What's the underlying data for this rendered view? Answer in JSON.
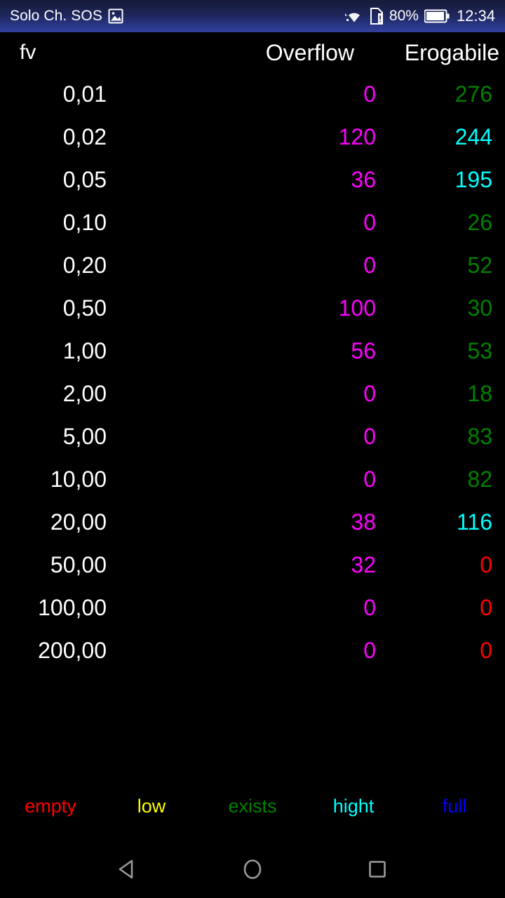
{
  "statusbar": {
    "carrier": "Solo Ch. SOS",
    "screenshot_icon": "image-icon",
    "wifi_icon": "wifi-icon",
    "sim_icon": "sim-card-alert-icon",
    "battery_percent": "80%",
    "battery_icon": "battery-icon",
    "clock": "12:34"
  },
  "table": {
    "headers": {
      "fv": "fv",
      "overflow": "Overflow",
      "erogabile": "Erogabile"
    },
    "rows": [
      {
        "fv": "0,01",
        "overflow": "0",
        "overflow_color": "#FF00FF",
        "erogabile": "276",
        "erogabile_color": "#008000"
      },
      {
        "fv": "0,02",
        "overflow": "120",
        "overflow_color": "#FF00FF",
        "erogabile": "244",
        "erogabile_color": "#00FFFF"
      },
      {
        "fv": "0,05",
        "overflow": "36",
        "overflow_color": "#FF00FF",
        "erogabile": "195",
        "erogabile_color": "#00FFFF"
      },
      {
        "fv": "0,10",
        "overflow": "0",
        "overflow_color": "#FF00FF",
        "erogabile": "26",
        "erogabile_color": "#008000"
      },
      {
        "fv": "0,20",
        "overflow": "0",
        "overflow_color": "#FF00FF",
        "erogabile": "52",
        "erogabile_color": "#008000"
      },
      {
        "fv": "0,50",
        "overflow": "100",
        "overflow_color": "#FF00FF",
        "erogabile": "30",
        "erogabile_color": "#008000"
      },
      {
        "fv": "1,00",
        "overflow": "56",
        "overflow_color": "#FF00FF",
        "erogabile": "53",
        "erogabile_color": "#008000"
      },
      {
        "fv": "2,00",
        "overflow": "0",
        "overflow_color": "#FF00FF",
        "erogabile": "18",
        "erogabile_color": "#008000"
      },
      {
        "fv": "5,00",
        "overflow": "0",
        "overflow_color": "#FF00FF",
        "erogabile": "83",
        "erogabile_color": "#008000"
      },
      {
        "fv": "10,00",
        "overflow": "0",
        "overflow_color": "#FF00FF",
        "erogabile": "82",
        "erogabile_color": "#008000"
      },
      {
        "fv": "20,00",
        "overflow": "38",
        "overflow_color": "#FF00FF",
        "erogabile": "116",
        "erogabile_color": "#00FFFF"
      },
      {
        "fv": "50,00",
        "overflow": "32",
        "overflow_color": "#FF00FF",
        "erogabile": "0",
        "erogabile_color": "#FF0000"
      },
      {
        "fv": "100,00",
        "overflow": "0",
        "overflow_color": "#FF00FF",
        "erogabile": "0",
        "erogabile_color": "#FF0000"
      },
      {
        "fv": "200,00",
        "overflow": "0",
        "overflow_color": "#FF00FF",
        "erogabile": "0",
        "erogabile_color": "#FF0000"
      }
    ]
  },
  "legend": [
    {
      "label": "empty",
      "color": "#FF0000"
    },
    {
      "label": "low",
      "color": "#FFFF00"
    },
    {
      "label": "exists",
      "color": "#008000"
    },
    {
      "label": "hight",
      "color": "#00FFFF"
    },
    {
      "label": "full",
      "color": "#0000FF"
    }
  ],
  "navbar": {
    "back": "back-triangle-icon",
    "home": "home-circle-icon",
    "recents": "recents-square-icon"
  }
}
